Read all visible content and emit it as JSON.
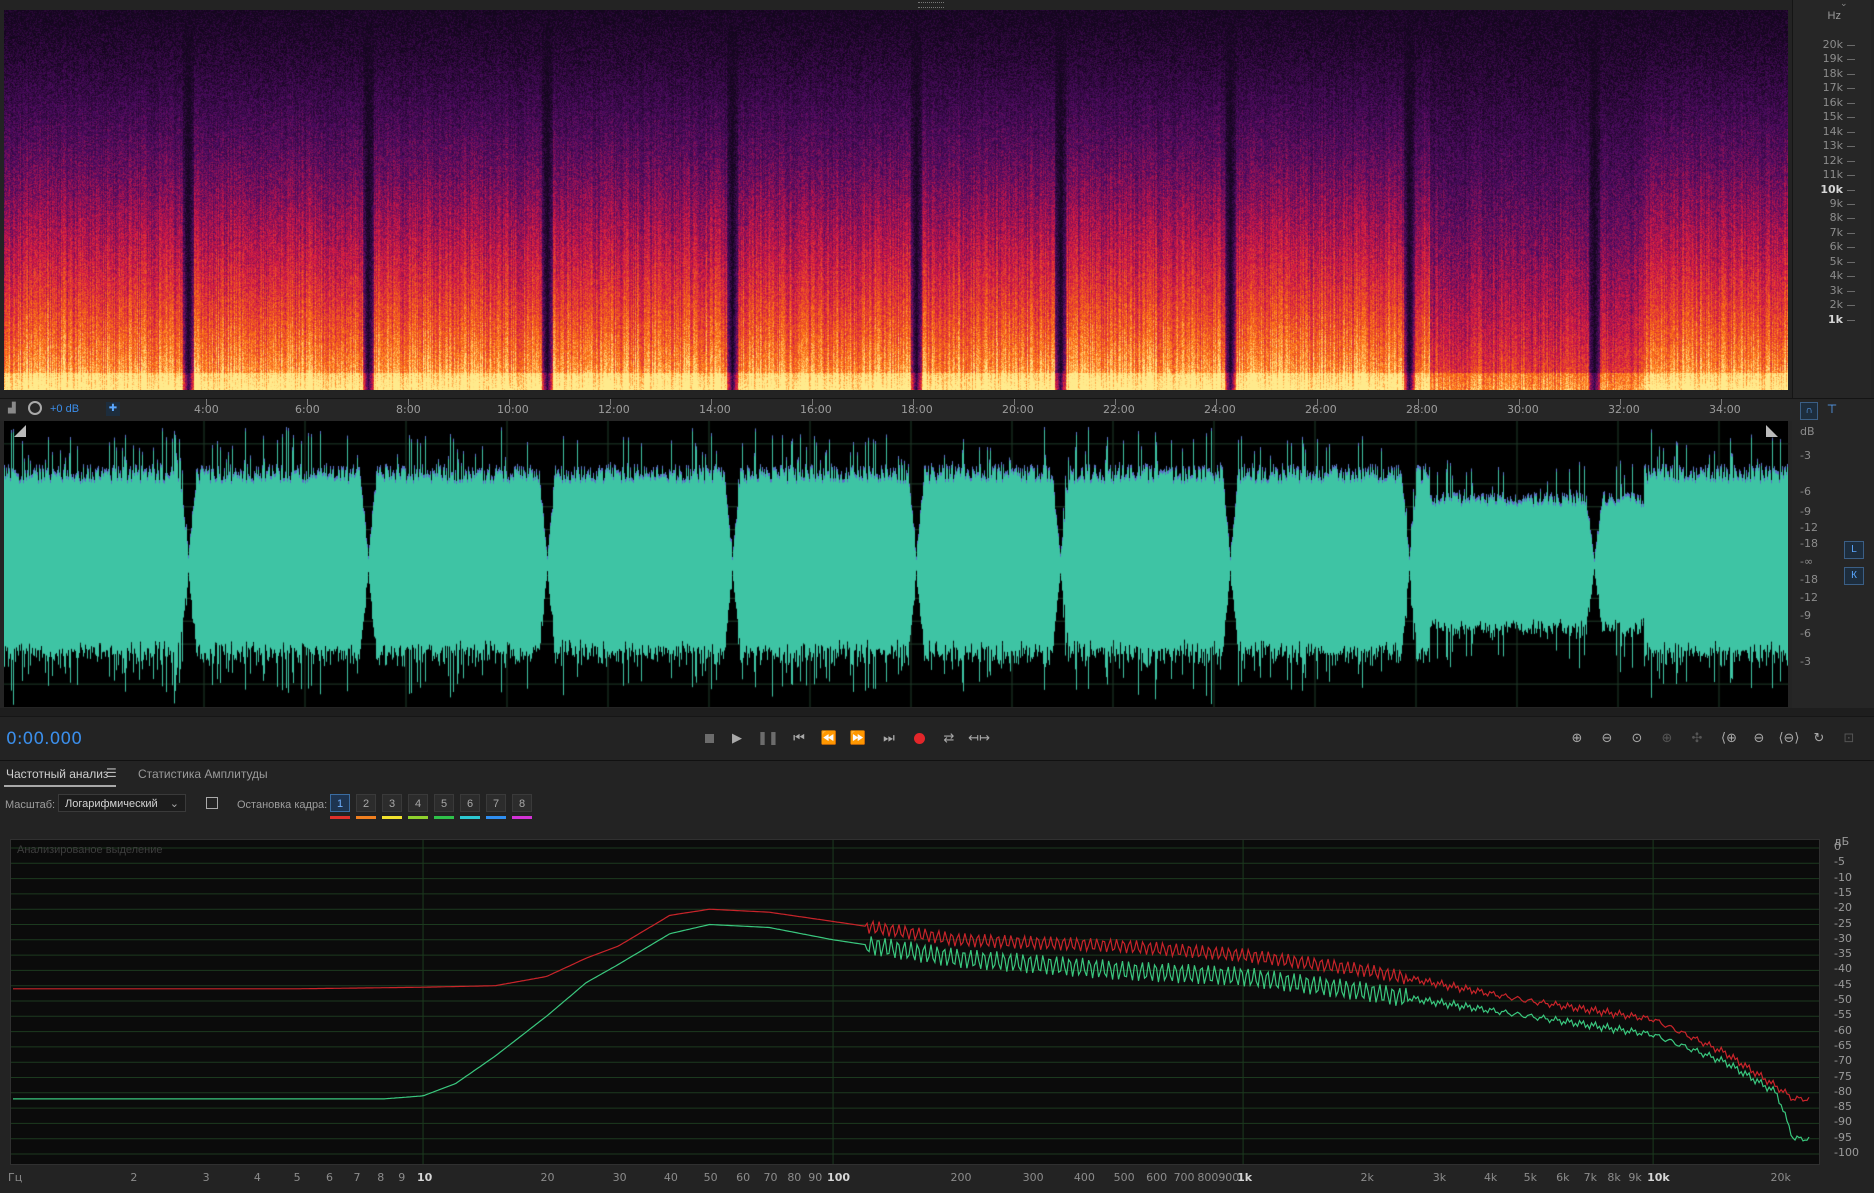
{
  "spectrogram": {
    "unit": "Hz",
    "freq_labels": [
      {
        "label": "20k",
        "bold": false
      },
      {
        "label": "19k",
        "bold": false
      },
      {
        "label": "18k",
        "bold": false
      },
      {
        "label": "17k",
        "bold": false
      },
      {
        "label": "16k",
        "bold": false
      },
      {
        "label": "15k",
        "bold": false
      },
      {
        "label": "14k",
        "bold": false
      },
      {
        "label": "13k",
        "bold": false
      },
      {
        "label": "12k",
        "bold": false
      },
      {
        "label": "11k",
        "bold": false
      },
      {
        "label": "10k",
        "bold": true
      },
      {
        "label": "9k",
        "bold": false
      },
      {
        "label": "8k",
        "bold": false
      },
      {
        "label": "7k",
        "bold": false
      },
      {
        "label": "6k",
        "bold": false
      },
      {
        "label": "5k",
        "bold": false
      },
      {
        "label": "4k",
        "bold": false
      },
      {
        "label": "3k",
        "bold": false
      },
      {
        "label": "2k",
        "bold": false
      },
      {
        "label": "1k",
        "bold": true
      }
    ],
    "gaps_min": [
      3.7,
      7.3,
      10.9,
      14.6,
      18.3,
      21.2,
      24.6,
      28.2,
      31.9
    ]
  },
  "ruler": {
    "gain": "+0 dB",
    "time_labels": [
      "4:00",
      "6:00",
      "8:00",
      "10:00",
      "12:00",
      "14:00",
      "16:00",
      "18:00",
      "20:00",
      "22:00",
      "24:00",
      "26:00",
      "28:00",
      "30:00",
      "32:00",
      "34:00"
    ]
  },
  "waveform": {
    "unit": "dB",
    "db_labels_top": [
      "-3",
      "-6",
      "-9",
      "-12",
      "-18",
      "-∞"
    ],
    "db_labels_bottom": [
      "-18",
      "-12",
      "-9",
      "-6",
      "-3"
    ],
    "channel_left": "L",
    "channel_right": "К",
    "color": "#3ec4a4"
  },
  "transport": {
    "time": "0:00.000"
  },
  "analysis": {
    "tab_active": "Частотный анализ",
    "tab_inactive": "Статистика Амплитуды",
    "scale_label": "Масштаб:",
    "scale_value": "Логарифмический",
    "freeze_label": "Остановка кадра:",
    "frames": [
      {
        "label": "1",
        "color": "#e0302a"
      },
      {
        "label": "2",
        "color": "#f07f1f"
      },
      {
        "label": "3",
        "color": "#f2e22e"
      },
      {
        "label": "4",
        "color": "#8fd12d"
      },
      {
        "label": "5",
        "color": "#2fc24a"
      },
      {
        "label": "6",
        "color": "#2cc8d2"
      },
      {
        "label": "7",
        "color": "#2f8ef0"
      },
      {
        "label": "8",
        "color": "#d332d6"
      }
    ],
    "graph_caption": "Анализированое выделение",
    "db_unit": "дБ",
    "db_labels": [
      "0",
      "-5",
      "-10",
      "-15",
      "-20",
      "-25",
      "-30",
      "-35",
      "-40",
      "-45",
      "-50",
      "-55",
      "-60",
      "-65",
      "-70",
      "-75",
      "-80",
      "-85",
      "-90",
      "-95",
      "-100"
    ],
    "freq_unit": "Гц",
    "freq_labels": [
      {
        "label": "2",
        "hz": 2
      },
      {
        "label": "3",
        "hz": 3
      },
      {
        "label": "4",
        "hz": 4
      },
      {
        "label": "5",
        "hz": 5
      },
      {
        "label": "6",
        "hz": 6
      },
      {
        "label": "7",
        "hz": 7
      },
      {
        "label": "8",
        "hz": 8
      },
      {
        "label": "9",
        "hz": 9
      },
      {
        "label": "10",
        "hz": 10,
        "bold": true
      },
      {
        "label": "20",
        "hz": 20
      },
      {
        "label": "30",
        "hz": 30
      },
      {
        "label": "40",
        "hz": 40
      },
      {
        "label": "50",
        "hz": 50
      },
      {
        "label": "60",
        "hz": 60
      },
      {
        "label": "70",
        "hz": 70
      },
      {
        "label": "80",
        "hz": 80
      },
      {
        "label": "90",
        "hz": 90
      },
      {
        "label": "100",
        "hz": 100,
        "bold": true
      },
      {
        "label": "200",
        "hz": 200
      },
      {
        "label": "300",
        "hz": 300
      },
      {
        "label": "400",
        "hz": 400
      },
      {
        "label": "500",
        "hz": 500
      },
      {
        "label": "600",
        "hz": 600
      },
      {
        "label": "700",
        "hz": 700
      },
      {
        "label": "800",
        "hz": 800
      },
      {
        "label": "900",
        "hz": 900
      },
      {
        "label": "1k",
        "hz": 1000,
        "bold": true
      },
      {
        "label": "2k",
        "hz": 2000
      },
      {
        "label": "3k",
        "hz": 3000
      },
      {
        "label": "4k",
        "hz": 4000
      },
      {
        "label": "5k",
        "hz": 5000
      },
      {
        "label": "6k",
        "hz": 6000
      },
      {
        "label": "7k",
        "hz": 7000
      },
      {
        "label": "8k",
        "hz": 8000
      },
      {
        "label": "9k",
        "hz": 9000
      },
      {
        "label": "10k",
        "hz": 10000,
        "bold": true
      },
      {
        "label": "20k",
        "hz": 20000
      }
    ]
  },
  "chart_data": {
    "type": "line",
    "xlabel": "Гц",
    "ylabel": "дБ",
    "xscale": "log",
    "xlim": [
      1,
      24000
    ],
    "ylim": [
      -100,
      0
    ],
    "series": [
      {
        "color": "#c8242a",
        "x": [
          1,
          5,
          10,
          15,
          20,
          25,
          30,
          40,
          50,
          70,
          100,
          200,
          500,
          1000,
          2000,
          5000,
          10000,
          15000,
          20000,
          22000
        ],
        "y": [
          -46,
          -46,
          -45.5,
          -45,
          -42,
          -36,
          -32,
          -22,
          -20,
          -21,
          -24,
          -30,
          -32,
          -35,
          -40,
          -50,
          -56,
          -67,
          -78,
          -82
        ]
      },
      {
        "color": "#3ac77e",
        "x": [
          1,
          5,
          8,
          10,
          12,
          15,
          20,
          25,
          30,
          40,
          50,
          70,
          100,
          200,
          500,
          1000,
          2000,
          5000,
          10000,
          15000,
          20000,
          22000
        ],
        "y": [
          -82,
          -82,
          -82,
          -81,
          -77,
          -68,
          -55,
          -44,
          -38,
          -28,
          -25,
          -26,
          -30,
          -36,
          -40,
          -42,
          -47,
          -55,
          -61,
          -70,
          -80,
          -95
        ]
      }
    ]
  }
}
